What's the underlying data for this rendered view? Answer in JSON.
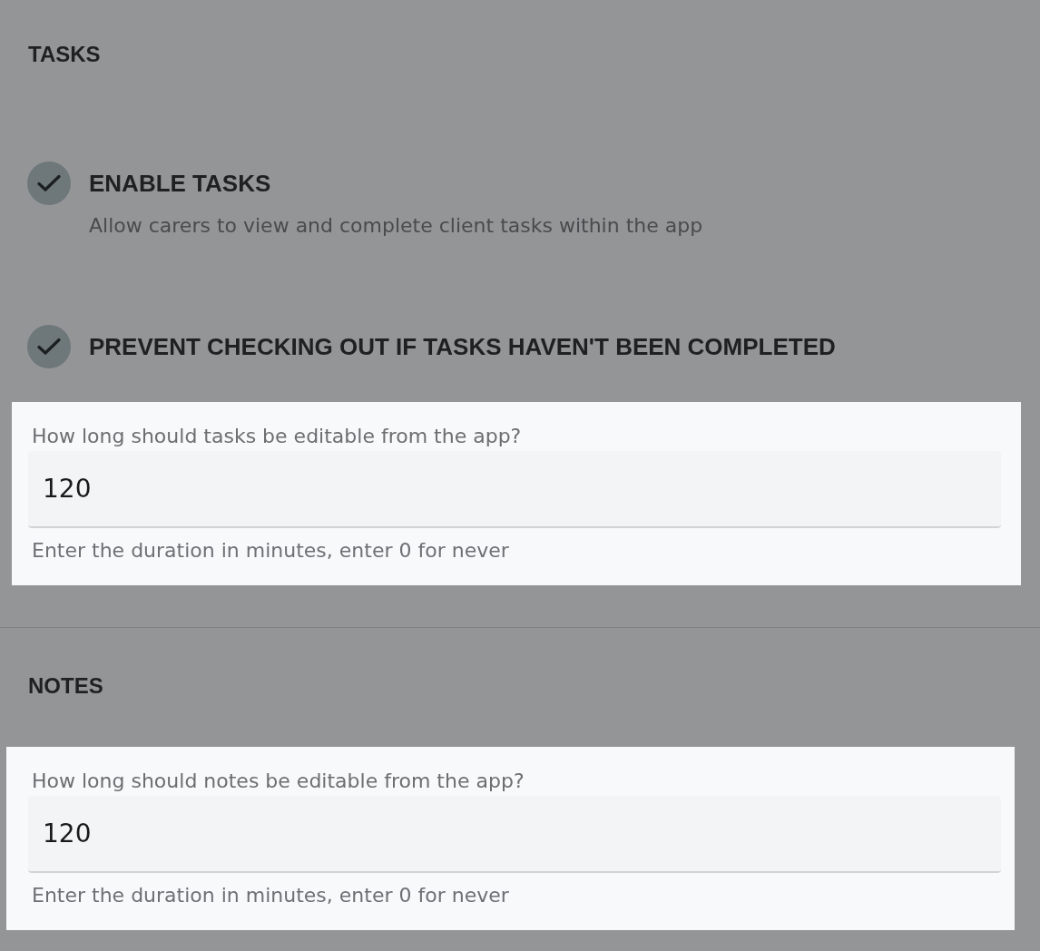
{
  "sections": [
    {
      "heading": "TASKS",
      "options": [
        {
          "label": "ENABLE TASKS",
          "description": "Allow carers to view and complete client tasks within the app",
          "checked": true
        },
        {
          "label": "PREVENT CHECKING OUT IF TASKS HAVEN'T BEEN COMPLETED",
          "checked": true
        }
      ],
      "field": {
        "label": "How long should tasks be editable from the app?",
        "value": "120",
        "helper": "Enter the duration in minutes, enter 0 for never"
      }
    },
    {
      "heading": "NOTES",
      "field": {
        "label": "How long should notes be editable from the app?",
        "value": "120",
        "helper": "Enter the duration in minutes, enter 0 for never"
      }
    }
  ]
}
